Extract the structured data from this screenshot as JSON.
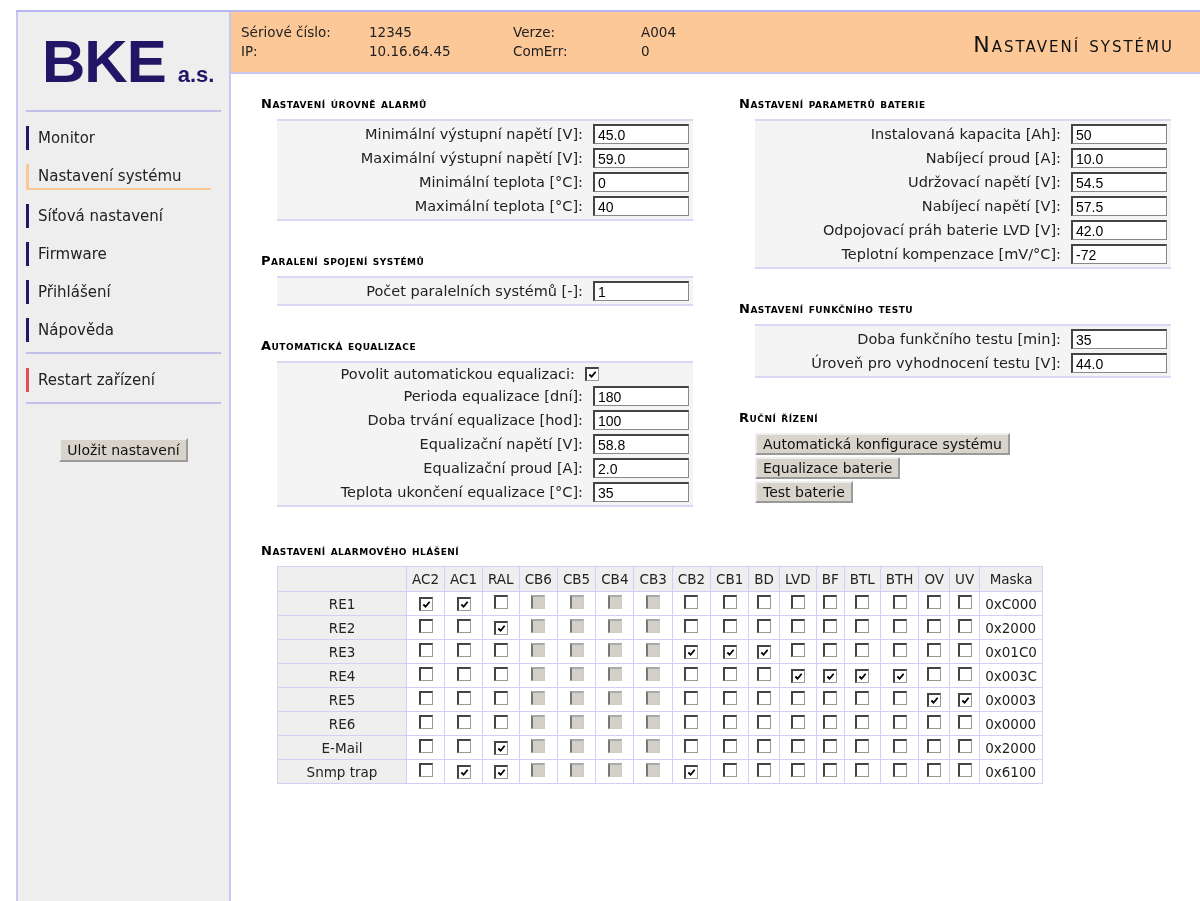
{
  "sidebar": {
    "logo": {
      "main": "BKE",
      "suffix": "a.s."
    },
    "groups": [
      [
        {
          "label": "Monitor",
          "color": "#231566",
          "selected": false
        },
        {
          "label": "Nastavení systému",
          "color": "#fdc897",
          "selected": true
        },
        {
          "label": "Síťová nastavení",
          "color": "#231566",
          "selected": false
        },
        {
          "label": "Firmware",
          "color": "#231566",
          "selected": false
        },
        {
          "label": "Přihlášení",
          "color": "#231566",
          "selected": false
        },
        {
          "label": "Nápověda",
          "color": "#231566",
          "selected": false
        }
      ],
      [
        {
          "label": "Restart zařízení",
          "color": "#e05050",
          "selected": false
        }
      ]
    ],
    "save_button": "Uložit nastavení"
  },
  "header": {
    "fields": [
      {
        "label": "Sériové číslo:",
        "value": "12345"
      },
      {
        "label": "Verze:",
        "value": "A004"
      },
      {
        "label": "IP:",
        "value": "10.16.64.45"
      },
      {
        "label": "ComErr:",
        "value": "0"
      }
    ],
    "title": "Nastavení systému"
  },
  "left_sections": [
    {
      "title": "Nastavení úrovně alarmů",
      "rows": [
        {
          "kind": "input",
          "label": "Minimální výstupní napětí [V]:",
          "value": "45.0"
        },
        {
          "kind": "input",
          "label": "Maximální výstupní napětí [V]:",
          "value": "59.0"
        },
        {
          "kind": "input",
          "label": "Minimální teplota [°C]:",
          "value": "0"
        },
        {
          "kind": "input",
          "label": "Maximální teplota [°C]:",
          "value": "40"
        }
      ]
    },
    {
      "title": "Paralení spojení systémů",
      "rows": [
        {
          "kind": "input",
          "label": "Počet paralelních systémů [-]:",
          "value": "1"
        }
      ]
    },
    {
      "title": "Automatická equalizace",
      "rows": [
        {
          "kind": "checkbox",
          "label": "Povolit automatickou equalizaci:",
          "checked": true
        },
        {
          "kind": "input",
          "label": "Perioda equalizace [dní]:",
          "value": "180"
        },
        {
          "kind": "input",
          "label": "Doba trvání equalizace [hod]:",
          "value": "100"
        },
        {
          "kind": "input",
          "label": "Equalizační napětí [V]:",
          "value": "58.8"
        },
        {
          "kind": "input",
          "label": "Equalizační proud [A]:",
          "value": "2.0"
        },
        {
          "kind": "input",
          "label": "Teplota ukončení equalizace [°C]:",
          "value": "35"
        }
      ]
    }
  ],
  "right_sections": [
    {
      "title": "Nastavení parametrů baterie",
      "rows": [
        {
          "kind": "input",
          "label": "Instalovaná kapacita [Ah]:",
          "value": "50"
        },
        {
          "kind": "input",
          "label": "Nabíjecí proud [A]:",
          "value": "10.0"
        },
        {
          "kind": "input",
          "label": "Udržovací napětí [V]:",
          "value": "54.5"
        },
        {
          "kind": "input",
          "label": "Nabíjecí napětí [V]:",
          "value": "57.5"
        },
        {
          "kind": "input",
          "label": "Odpojovací práh baterie LVD [V]:",
          "value": "42.0"
        },
        {
          "kind": "input",
          "label": "Teplotní kompenzace [mV/°C]:",
          "value": "-72"
        }
      ]
    },
    {
      "title": "Nastavení funkčního testu",
      "rows": [
        {
          "kind": "input",
          "label": "Doba funkčního testu [min]:",
          "value": "35"
        },
        {
          "kind": "input",
          "label": "Úroveň pro vyhodnocení testu [V]:",
          "value": "44.0"
        }
      ]
    }
  ],
  "manual_control": {
    "title": "Ruční řízení",
    "buttons": [
      "Automatická konfigurace systému",
      "Equalizace baterie",
      "Test baterie"
    ]
  },
  "alarm_table": {
    "title": "Nastavení alarmového hlášení",
    "columns": [
      "AC2",
      "AC1",
      "RAL",
      "CB6",
      "CB5",
      "CB4",
      "CB3",
      "CB2",
      "CB1",
      "BD",
      "LVD",
      "BF",
      "BTL",
      "BTH",
      "OV",
      "UV"
    ],
    "mask_column": "Maska",
    "rows": [
      {
        "label": "RE1",
        "mask": "0xC000",
        "cells": [
          {
            "checked": true,
            "disabled": false
          },
          {
            "checked": true,
            "disabled": false
          },
          {
            "checked": false,
            "disabled": false
          },
          {
            "checked": false,
            "disabled": true
          },
          {
            "checked": false,
            "disabled": true
          },
          {
            "checked": false,
            "disabled": true
          },
          {
            "checked": false,
            "disabled": true
          },
          {
            "checked": false,
            "disabled": false
          },
          {
            "checked": false,
            "disabled": false
          },
          {
            "checked": false,
            "disabled": false
          },
          {
            "checked": false,
            "disabled": false
          },
          {
            "checked": false,
            "disabled": false
          },
          {
            "checked": false,
            "disabled": false
          },
          {
            "checked": false,
            "disabled": false
          },
          {
            "checked": false,
            "disabled": false
          },
          {
            "checked": false,
            "disabled": false
          }
        ]
      },
      {
        "label": "RE2",
        "mask": "0x2000",
        "cells": [
          {
            "checked": false,
            "disabled": false
          },
          {
            "checked": false,
            "disabled": false
          },
          {
            "checked": true,
            "disabled": false
          },
          {
            "checked": false,
            "disabled": true
          },
          {
            "checked": false,
            "disabled": true
          },
          {
            "checked": false,
            "disabled": true
          },
          {
            "checked": false,
            "disabled": true
          },
          {
            "checked": false,
            "disabled": false
          },
          {
            "checked": false,
            "disabled": false
          },
          {
            "checked": false,
            "disabled": false
          },
          {
            "checked": false,
            "disabled": false
          },
          {
            "checked": false,
            "disabled": false
          },
          {
            "checked": false,
            "disabled": false
          },
          {
            "checked": false,
            "disabled": false
          },
          {
            "checked": false,
            "disabled": false
          },
          {
            "checked": false,
            "disabled": false
          }
        ]
      },
      {
        "label": "RE3",
        "mask": "0x01C0",
        "cells": [
          {
            "checked": false,
            "disabled": false
          },
          {
            "checked": false,
            "disabled": false
          },
          {
            "checked": false,
            "disabled": false
          },
          {
            "checked": false,
            "disabled": true
          },
          {
            "checked": false,
            "disabled": true
          },
          {
            "checked": false,
            "disabled": true
          },
          {
            "checked": false,
            "disabled": true
          },
          {
            "checked": true,
            "disabled": false
          },
          {
            "checked": true,
            "disabled": false
          },
          {
            "checked": true,
            "disabled": false
          },
          {
            "checked": false,
            "disabled": false
          },
          {
            "checked": false,
            "disabled": false
          },
          {
            "checked": false,
            "disabled": false
          },
          {
            "checked": false,
            "disabled": false
          },
          {
            "checked": false,
            "disabled": false
          },
          {
            "checked": false,
            "disabled": false
          }
        ]
      },
      {
        "label": "RE4",
        "mask": "0x003C",
        "cells": [
          {
            "checked": false,
            "disabled": false
          },
          {
            "checked": false,
            "disabled": false
          },
          {
            "checked": false,
            "disabled": false
          },
          {
            "checked": false,
            "disabled": true
          },
          {
            "checked": false,
            "disabled": true
          },
          {
            "checked": false,
            "disabled": true
          },
          {
            "checked": false,
            "disabled": true
          },
          {
            "checked": false,
            "disabled": false
          },
          {
            "checked": false,
            "disabled": false
          },
          {
            "checked": false,
            "disabled": false
          },
          {
            "checked": true,
            "disabled": false
          },
          {
            "checked": true,
            "disabled": false
          },
          {
            "checked": true,
            "disabled": false
          },
          {
            "checked": true,
            "disabled": false
          },
          {
            "checked": false,
            "disabled": false
          },
          {
            "checked": false,
            "disabled": false
          }
        ]
      },
      {
        "label": "RE5",
        "mask": "0x0003",
        "cells": [
          {
            "checked": false,
            "disabled": false
          },
          {
            "checked": false,
            "disabled": false
          },
          {
            "checked": false,
            "disabled": false
          },
          {
            "checked": false,
            "disabled": true
          },
          {
            "checked": false,
            "disabled": true
          },
          {
            "checked": false,
            "disabled": true
          },
          {
            "checked": false,
            "disabled": true
          },
          {
            "checked": false,
            "disabled": false
          },
          {
            "checked": false,
            "disabled": false
          },
          {
            "checked": false,
            "disabled": false
          },
          {
            "checked": false,
            "disabled": false
          },
          {
            "checked": false,
            "disabled": false
          },
          {
            "checked": false,
            "disabled": false
          },
          {
            "checked": false,
            "disabled": false
          },
          {
            "checked": true,
            "disabled": false
          },
          {
            "checked": true,
            "disabled": false
          }
        ]
      },
      {
        "label": "RE6",
        "mask": "0x0000",
        "cells": [
          {
            "checked": false,
            "disabled": false
          },
          {
            "checked": false,
            "disabled": false
          },
          {
            "checked": false,
            "disabled": false
          },
          {
            "checked": false,
            "disabled": true
          },
          {
            "checked": false,
            "disabled": true
          },
          {
            "checked": false,
            "disabled": true
          },
          {
            "checked": false,
            "disabled": true
          },
          {
            "checked": false,
            "disabled": false
          },
          {
            "checked": false,
            "disabled": false
          },
          {
            "checked": false,
            "disabled": false
          },
          {
            "checked": false,
            "disabled": false
          },
          {
            "checked": false,
            "disabled": false
          },
          {
            "checked": false,
            "disabled": false
          },
          {
            "checked": false,
            "disabled": false
          },
          {
            "checked": false,
            "disabled": false
          },
          {
            "checked": false,
            "disabled": false
          }
        ]
      },
      {
        "label": "E-Mail",
        "mask": "0x2000",
        "cells": [
          {
            "checked": false,
            "disabled": false
          },
          {
            "checked": false,
            "disabled": false
          },
          {
            "checked": true,
            "disabled": false
          },
          {
            "checked": false,
            "disabled": true
          },
          {
            "checked": false,
            "disabled": true
          },
          {
            "checked": false,
            "disabled": true
          },
          {
            "checked": false,
            "disabled": true
          },
          {
            "checked": false,
            "disabled": false
          },
          {
            "checked": false,
            "disabled": false
          },
          {
            "checked": false,
            "disabled": false
          },
          {
            "checked": false,
            "disabled": false
          },
          {
            "checked": false,
            "disabled": false
          },
          {
            "checked": false,
            "disabled": false
          },
          {
            "checked": false,
            "disabled": false
          },
          {
            "checked": false,
            "disabled": false
          },
          {
            "checked": false,
            "disabled": false
          }
        ]
      },
      {
        "label": "Snmp trap",
        "mask": "0x6100",
        "cells": [
          {
            "checked": false,
            "disabled": false
          },
          {
            "checked": true,
            "disabled": false
          },
          {
            "checked": true,
            "disabled": false
          },
          {
            "checked": false,
            "disabled": true
          },
          {
            "checked": false,
            "disabled": true
          },
          {
            "checked": false,
            "disabled": true
          },
          {
            "checked": false,
            "disabled": true
          },
          {
            "checked": true,
            "disabled": false
          },
          {
            "checked": false,
            "disabled": false
          },
          {
            "checked": false,
            "disabled": false
          },
          {
            "checked": false,
            "disabled": false
          },
          {
            "checked": false,
            "disabled": false
          },
          {
            "checked": false,
            "disabled": false
          },
          {
            "checked": false,
            "disabled": false
          },
          {
            "checked": false,
            "disabled": false
          },
          {
            "checked": false,
            "disabled": false
          }
        ]
      }
    ]
  }
}
